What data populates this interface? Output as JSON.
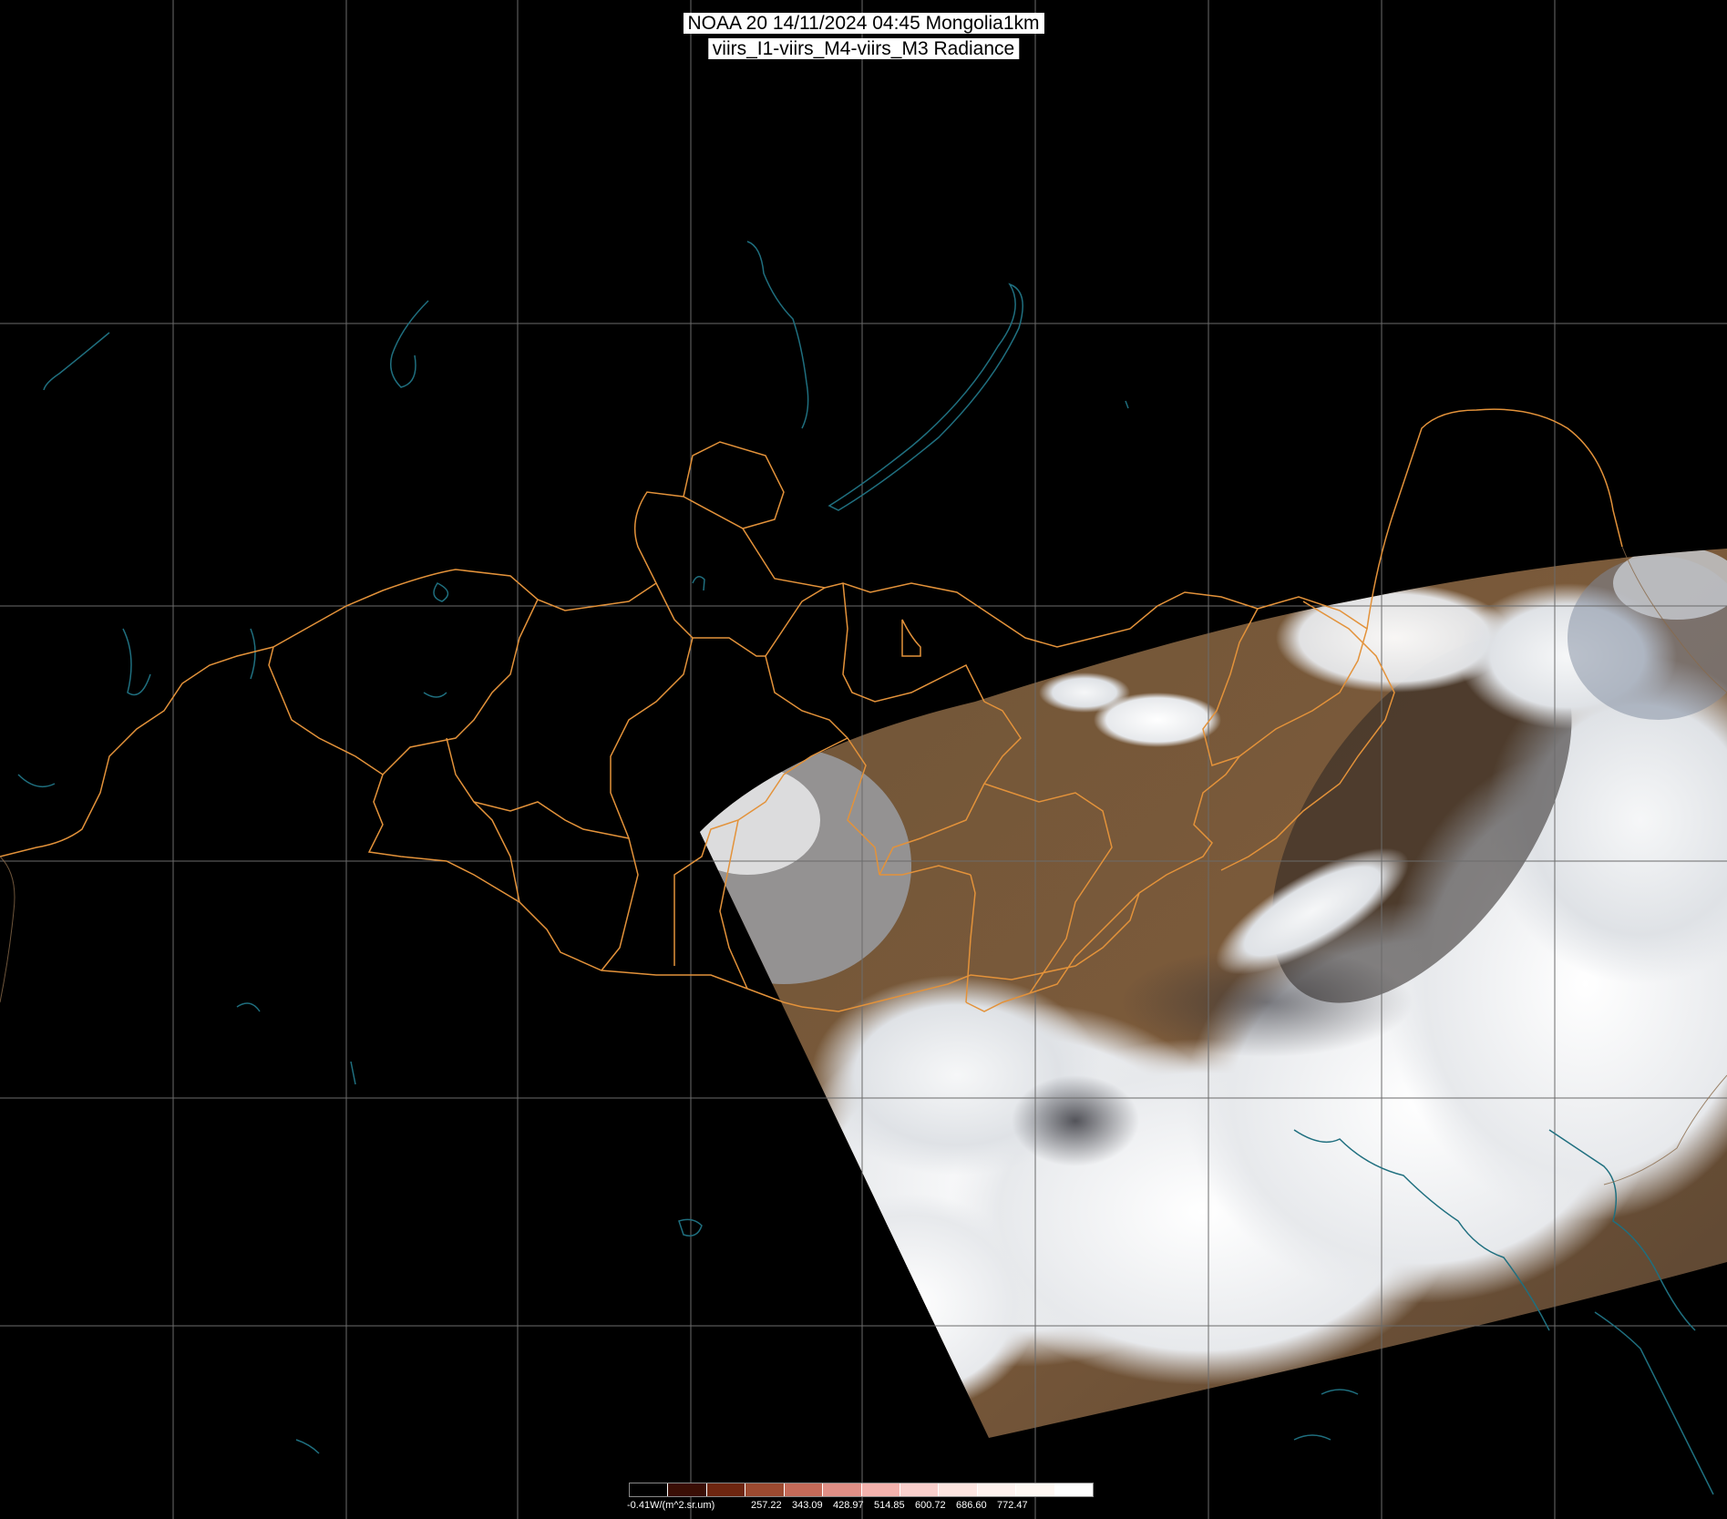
{
  "title": {
    "line1": "NOAA 20 14/11/2024 04:45 Mongolia1km",
    "line2": "viirs_I1-viirs_M4-viirs_M3 Radiance"
  },
  "colors": {
    "background": "#000000",
    "grid": "#6b6b6b",
    "water_boundaries": "#1f6f7f",
    "province_boundaries": "#e3923a",
    "land": "#6e4f33",
    "cloud": "#f2f3f4"
  },
  "legend": {
    "labels": [
      "-0.41W/(m^2.sr.um)",
      "257.22",
      "343.09",
      "428.97",
      "514.85",
      "600.72",
      "686.60",
      "772.47"
    ],
    "swatches": [
      "#000000",
      "#3a0e05",
      "#6e2610",
      "#9c4a30",
      "#c46a58",
      "#e08f86",
      "#f3b2ad",
      "#f9cfcc",
      "#fde4e0",
      "#fff2ee",
      "#fff8f3",
      "#ffffff"
    ]
  }
}
